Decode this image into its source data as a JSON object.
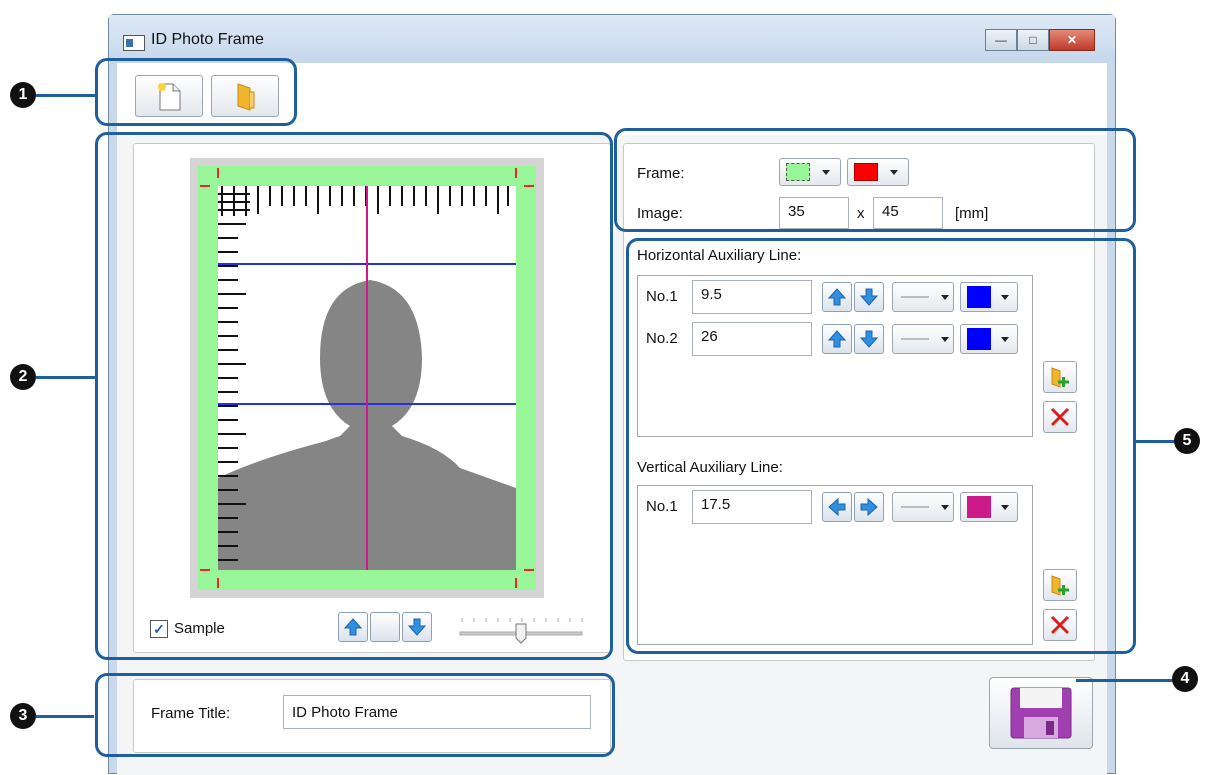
{
  "window": {
    "title": "ID Photo Frame",
    "icon": "window-icon"
  },
  "toolbar": {
    "new_icon": "new-file-icon",
    "open_icon": "open-folder-icon"
  },
  "frame_settings": {
    "frame_label": "Frame:",
    "frame_fill_color": "#98f598",
    "frame_line_color": "#ff0000",
    "image_label": "Image:",
    "image_width": "35",
    "image_x": "x",
    "image_height": "45",
    "image_unit": "[mm]"
  },
  "horizontal": {
    "heading": "Horizontal Auxiliary Line:",
    "lines": [
      {
        "label": "No.1",
        "value": "9.5",
        "color": "#0000ff"
      },
      {
        "label": "No.2",
        "value": "26",
        "color": "#0000ff"
      }
    ]
  },
  "vertical": {
    "heading": "Vertical Auxiliary Line:",
    "lines": [
      {
        "label": "No.1",
        "value": "17.5",
        "color": "#cc1a8a"
      }
    ]
  },
  "preview": {
    "sample_label": "Sample",
    "sample_checked": true
  },
  "frame_title": {
    "label": "Frame Title:",
    "value": "ID Photo Frame"
  },
  "callouts": [
    "1",
    "2",
    "3",
    "4",
    "5"
  ],
  "colors": {
    "callout": "#1f5f9e",
    "accent_blue": "#2f8fe0"
  }
}
